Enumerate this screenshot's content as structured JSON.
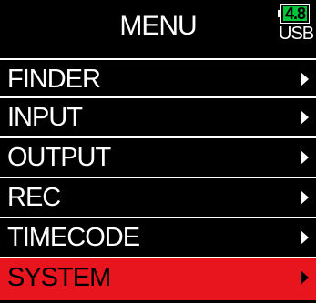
{
  "header": {
    "title": "MENU",
    "battery": {
      "voltage": "4.8",
      "source": "USB",
      "fill_color": "#00c63a"
    }
  },
  "menu": {
    "items": [
      {
        "label": "FINDER",
        "selected": false
      },
      {
        "label": "INPUT",
        "selected": false
      },
      {
        "label": "OUTPUT",
        "selected": false
      },
      {
        "label": "REC",
        "selected": false
      },
      {
        "label": "TIMECODE",
        "selected": false
      },
      {
        "label": "SYSTEM",
        "selected": true
      }
    ],
    "arrow_icon": "chevron-right-icon",
    "selected_color": "#e8141e"
  }
}
